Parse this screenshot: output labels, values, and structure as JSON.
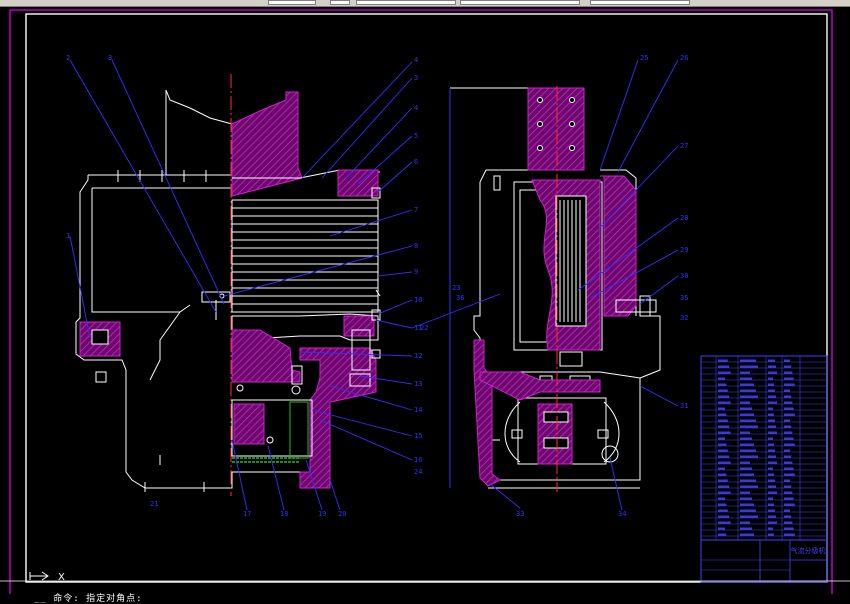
{
  "drawing": {
    "left_view_callouts": [
      "2",
      "3",
      "1",
      "4",
      "3",
      "4",
      "5",
      "6",
      "7",
      "8",
      "9",
      "10",
      "11",
      "12",
      "13",
      "14",
      "15",
      "16",
      "17",
      "18",
      "19",
      "20",
      "21",
      "22",
      "23",
      "24"
    ],
    "right_view_callouts": [
      "25",
      "26",
      "27",
      "28",
      "29",
      "30",
      "31",
      "32",
      "33",
      "34",
      "35",
      "36"
    ],
    "colors": {
      "outline": "#ffffff",
      "section": "#d020d0",
      "leader": "#3030ff",
      "frame": "#c000c0",
      "centerline": "#ff3030",
      "green": "#20c020",
      "title_block": "#4040ff"
    },
    "title_block_label": "气流分级机"
  },
  "ucs": {
    "x_label": "X",
    "icon": "ucs-icon"
  },
  "command_line": {
    "text": "__ 命令: 指定对角点:"
  }
}
